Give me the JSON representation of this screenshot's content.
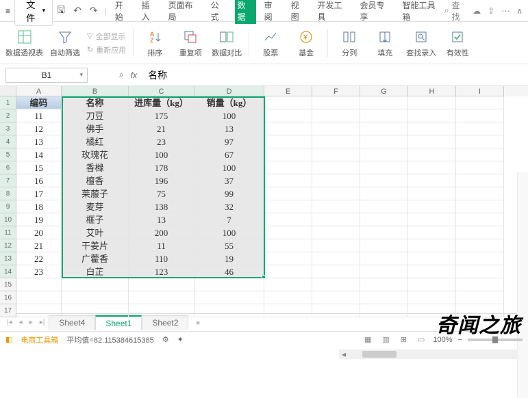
{
  "titlebar": {
    "file_label": "文件",
    "search_placeholder": "查找"
  },
  "menu_tabs": [
    "开始",
    "插入",
    "页面布局",
    "公式",
    "数据",
    "审阅",
    "视图",
    "开发工具",
    "会员专享",
    "智能工具箱"
  ],
  "active_menu_tab": 4,
  "ribbon": {
    "pivot": "数据透视表",
    "filter": "自动筛选",
    "show_all": "全部显示",
    "reapply": "重新应用",
    "sort": "排序",
    "dedup": "重复项",
    "compare": "数据对比",
    "stock": "股票",
    "fund": "基金",
    "text_cols": "分列",
    "fill": "填充",
    "find_entry": "查找录入",
    "validity": "有效性"
  },
  "name_box": "B1",
  "formula_value": "名称",
  "columns": [
    "A",
    "B",
    "C",
    "D",
    "E",
    "F",
    "G",
    "H",
    "I"
  ],
  "header_row": [
    "编码",
    "名称",
    "进库量（kg）",
    "销量（kg）"
  ],
  "chart_data": {
    "type": "table",
    "columns": [
      "编码",
      "名称",
      "进库量（kg）",
      "销量（kg）"
    ],
    "rows": [
      [
        11,
        "刀豆",
        175,
        100
      ],
      [
        12,
        "佛手",
        21,
        13
      ],
      [
        13,
        "橘红",
        23,
        97
      ],
      [
        14,
        "玫瑰花",
        100,
        67
      ],
      [
        15,
        "香橼",
        178,
        100
      ],
      [
        16,
        "檀香",
        196,
        37
      ],
      [
        17,
        "莱菔子",
        75,
        99
      ],
      [
        18,
        "麦芽",
        138,
        32
      ],
      [
        19,
        "榧子",
        13,
        7
      ],
      [
        20,
        "艾叶",
        200,
        100
      ],
      [
        21,
        "干姜片",
        11,
        55
      ],
      [
        22,
        "广藿香",
        110,
        19
      ],
      [
        23,
        "白芷",
        123,
        46
      ]
    ]
  },
  "sheet_tabs": [
    "Sheet4",
    "Sheet1",
    "Sheet2"
  ],
  "active_sheet": 1,
  "status": {
    "app": "电商工具箱",
    "avg": "平均值=82.115384615385",
    "zoom": "100%"
  },
  "watermark": "奇闻之旅",
  "colors": {
    "accent": "#0aa86e"
  }
}
